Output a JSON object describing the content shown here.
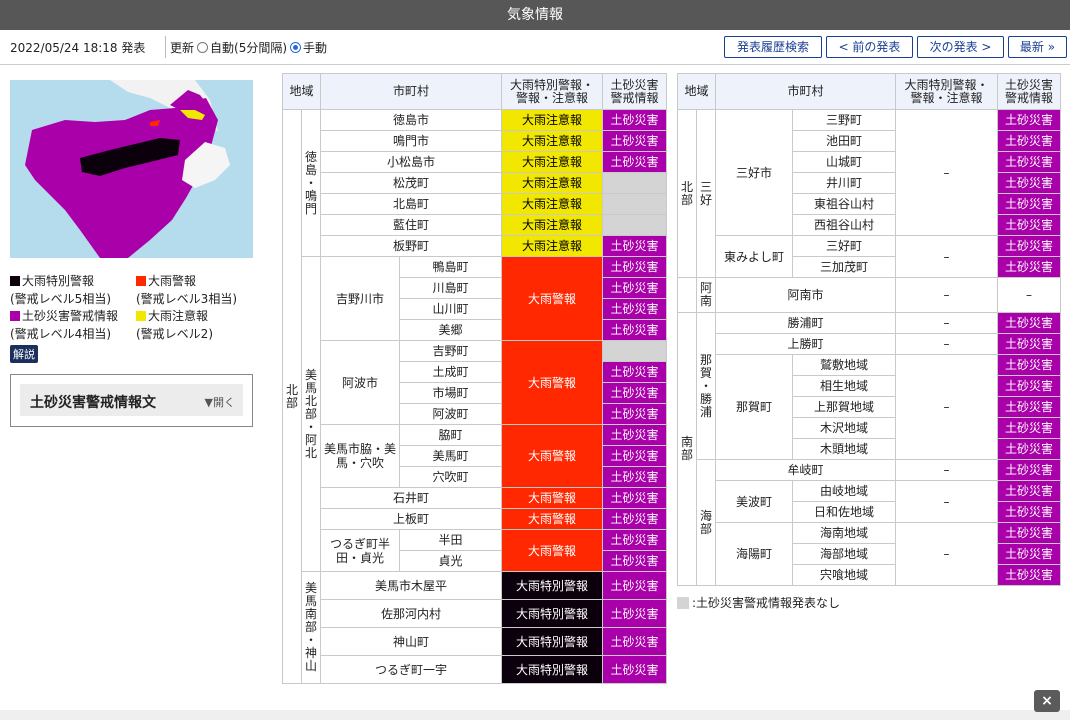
{
  "title": "気象情報",
  "issued": "2022/05/24 18:18 発表",
  "update": {
    "label": "更新",
    "auto": "自動(5分間隔)",
    "manual": "手動"
  },
  "nav": {
    "history": "発表履歴検索",
    "prev": "< 前の発表",
    "next": "次の発表 >",
    "latest": "最新 »"
  },
  "legend": [
    {
      "label": "大雨特別警報",
      "sub": "(警戒レベル5相当)",
      "color": "#0c000c"
    },
    {
      "label": "大雨警報",
      "sub": "(警戒レベル3相当)",
      "color": "#ff2800"
    },
    {
      "label": "土砂災害警戒情報",
      "sub": "(警戒レベル4相当)",
      "color": "#aa00aa"
    },
    {
      "label": "大雨注意報",
      "sub": "(警戒レベル2)",
      "color": "#f2e700"
    }
  ],
  "kaisetsu": "解説",
  "doc": {
    "title": "土砂災害警戒情報文",
    "open": "▼開く"
  },
  "headers": {
    "region": "地域",
    "municipality": "市町村",
    "rain_line1": "大雨特別警報・",
    "rain_line2": "警報・注意報",
    "landslide_line1": "土砂災害",
    "landslide_line2": "警戒情報"
  },
  "left_table": {
    "region_main": "北部",
    "groups": [
      {
        "label": "徳島・鳴門"
      },
      {
        "label": "美馬北部・阿北"
      },
      {
        "label": "美馬南部・神山"
      }
    ],
    "subgroups": [
      "吉野川市",
      "阿波市",
      "美馬市脇・美馬・穴吹",
      "つるぎ町半田・貞光"
    ],
    "rows": [
      {
        "name": "徳島市",
        "rain": "大雨注意報",
        "ls": "土砂災害"
      },
      {
        "name": "鳴門市",
        "rain": "大雨注意報",
        "ls": "土砂災害"
      },
      {
        "name": "小松島市",
        "rain": "大雨注意報",
        "ls": "土砂災害"
      },
      {
        "name": "松茂町",
        "rain": "大雨注意報",
        "ls": ""
      },
      {
        "name": "北島町",
        "rain": "大雨注意報",
        "ls": ""
      },
      {
        "name": "藍住町",
        "rain": "大雨注意報",
        "ls": ""
      },
      {
        "name": "板野町",
        "rain": "大雨注意報",
        "ls": "土砂災害"
      },
      {
        "name": "鴨島町",
        "ls": "土砂災害"
      },
      {
        "name": "川島町",
        "ls": "土砂災害"
      },
      {
        "name": "山川町",
        "ls": "土砂災害"
      },
      {
        "name": "美郷",
        "ls": "土砂災害"
      },
      {
        "name": "吉野町",
        "ls": ""
      },
      {
        "name": "土成町",
        "ls": "土砂災害"
      },
      {
        "name": "市場町",
        "ls": "土砂災害"
      },
      {
        "name": "阿波町",
        "ls": "土砂災害"
      },
      {
        "name": "脇町",
        "ls": "土砂災害"
      },
      {
        "name": "美馬町",
        "ls": "土砂災害"
      },
      {
        "name": "穴吹町",
        "ls": "土砂災害"
      },
      {
        "name": "石井町",
        "rain": "大雨警報",
        "ls": "土砂災害"
      },
      {
        "name": "上板町",
        "rain": "大雨警報",
        "ls": "土砂災害"
      },
      {
        "name": "半田",
        "ls": "土砂災害"
      },
      {
        "name": "貞光",
        "ls": "土砂災害"
      },
      {
        "name": "美馬市木屋平",
        "rain": "大雨特別警報",
        "ls": "土砂災害"
      },
      {
        "name": "佐那河内村",
        "rain": "大雨特別警報",
        "ls": "土砂災害"
      },
      {
        "name": "神山町",
        "rain": "大雨特別警報",
        "ls": "土砂災害"
      },
      {
        "name": "つるぎ町一宇",
        "rain": "大雨特別警報",
        "ls": "土砂災害"
      }
    ],
    "merged_rain": [
      "大雨警報",
      "大雨警報",
      "大雨警報",
      "大雨警報"
    ]
  },
  "right_table": {
    "north": "北部",
    "south": "南部",
    "g_miyoshi": "三好",
    "g_anan": "阿南",
    "g_naka": "那賀・勝浦",
    "g_kaifu": "海部",
    "miyoshi_city": "三好市",
    "higashimiyoshi": "東みよし町",
    "naka_town": "那賀町",
    "minami_town": "美波町",
    "kaiyo_town": "海陽町",
    "dash": "–",
    "rows": [
      {
        "name": "三野町",
        "ls": "土砂災害"
      },
      {
        "name": "池田町",
        "ls": "土砂災害"
      },
      {
        "name": "山城町",
        "ls": "土砂災害"
      },
      {
        "name": "井川町",
        "ls": "土砂災害"
      },
      {
        "name": "東祖谷山村",
        "ls": "土砂災害"
      },
      {
        "name": "西祖谷山村",
        "ls": "土砂災害"
      },
      {
        "name": "三好町",
        "ls": "土砂災害"
      },
      {
        "name": "三加茂町",
        "ls": "土砂災害"
      },
      {
        "name": "阿南市",
        "rain": "–",
        "ls": "–"
      },
      {
        "name": "勝浦町",
        "rain": "–",
        "ls": "土砂災害"
      },
      {
        "name": "上勝町",
        "rain": "–",
        "ls": "土砂災害"
      },
      {
        "name": "鷲敷地域",
        "ls": "土砂災害"
      },
      {
        "name": "相生地域",
        "ls": "土砂災害"
      },
      {
        "name": "上那賀地域",
        "ls": "土砂災害"
      },
      {
        "name": "木沢地域",
        "ls": "土砂災害"
      },
      {
        "name": "木頭地域",
        "ls": "土砂災害"
      },
      {
        "name": "牟岐町",
        "rain": "–",
        "ls": "土砂災害"
      },
      {
        "name": "由岐地域",
        "ls": "土砂災害"
      },
      {
        "name": "日和佐地域",
        "ls": "土砂災害"
      },
      {
        "name": "海南地域",
        "ls": "土砂災害"
      },
      {
        "name": "海部地域",
        "ls": "土砂災害"
      },
      {
        "name": "宍喰地域",
        "ls": "土砂災害"
      }
    ]
  },
  "note": ":土砂災害警戒情報発表なし",
  "close": "×"
}
